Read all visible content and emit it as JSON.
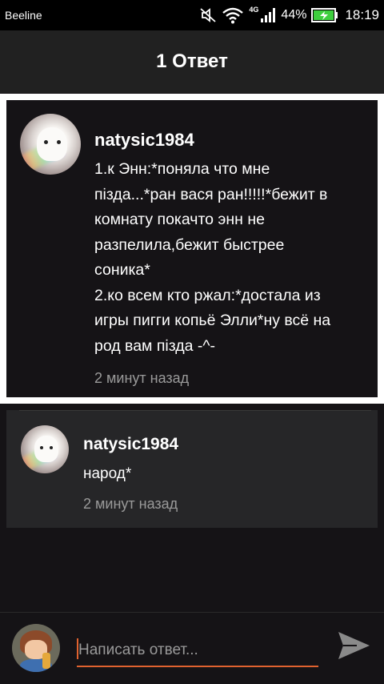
{
  "status_bar": {
    "carrier": "Beeline",
    "network_type": "4G",
    "battery_percent": "44%",
    "time": "18:19"
  },
  "app_bar": {
    "title": "1 Ответ"
  },
  "main_comment": {
    "username": "natysic1984",
    "text": "1.к Энн:*поняла что мне\nпізда...*ран вася ран!!!!!*бежит в\nкомнату покачто энн не\nразпелила,бежит быстрее\nсоника*\n2.ко всем кто ржал:*достала из\nигры пигги копьё Элли*ну всё на\nрод вам пізда -^-",
    "timestamp": "2 минут назад"
  },
  "reply": {
    "username": "natysic1984",
    "text": "народ*",
    "timestamp": "2 минут назад"
  },
  "composer": {
    "placeholder": "Написать ответ...",
    "value": ""
  },
  "colors": {
    "background": "#151316",
    "app_bar": "#212121",
    "reply_card": "#262628",
    "accent": "#e0622f",
    "muted_text": "#9a9a9a",
    "battery_green": "#3ecf3e"
  },
  "icons": [
    "mute-icon",
    "wifi-icon",
    "signal-icon",
    "battery-charging-icon",
    "send-icon"
  ]
}
